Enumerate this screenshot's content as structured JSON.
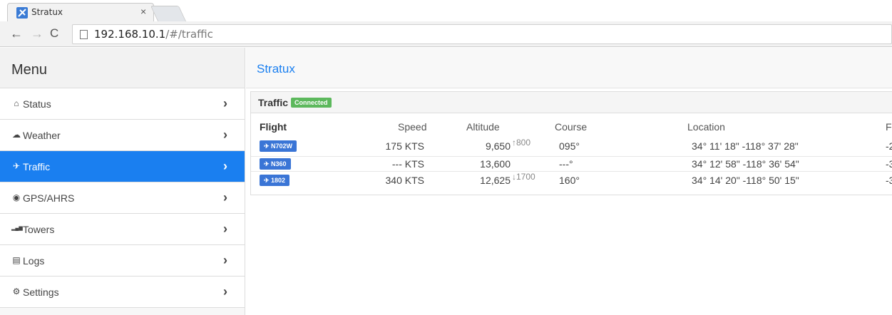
{
  "browser": {
    "tab_title": "Stratux",
    "tab_close": "×",
    "url_host": "192.168.10.1",
    "url_path": "/#/traffic",
    "back_glyph": "←",
    "forward_glyph": "→",
    "reload_glyph": "C"
  },
  "sidebar": {
    "title": "Menu",
    "items": [
      {
        "label": "Status",
        "icon": "home-icon",
        "glyph": "⌂",
        "active": false
      },
      {
        "label": "Weather",
        "icon": "cloud-icon",
        "glyph": "☁",
        "active": false
      },
      {
        "label": "Traffic",
        "icon": "plane-icon",
        "glyph": "✈",
        "active": true
      },
      {
        "label": "GPS/AHRS",
        "icon": "globe-icon",
        "glyph": "◉",
        "active": false
      },
      {
        "label": "Towers",
        "icon": "signal-icon",
        "glyph": "▂▄▆",
        "active": false
      },
      {
        "label": "Logs",
        "icon": "file-icon",
        "glyph": "▤",
        "active": false
      },
      {
        "label": "Settings",
        "icon": "gear-icon",
        "glyph": "⚙",
        "active": false
      }
    ],
    "chevron": "›"
  },
  "header": {
    "title": "Stratux"
  },
  "traffic": {
    "panel_title": "Traffic",
    "status_badge": "Connected",
    "columns": {
      "flight": "Flight",
      "speed": "Speed",
      "altitude": "Altitude",
      "course": "Course",
      "location": "Location",
      "p": "F"
    },
    "rows": [
      {
        "flight": "✈ N702W",
        "speed": "175 KTS",
        "altitude": "9,650",
        "vs": "↑800",
        "course": "095°",
        "location": "34° 11' 18\" -118° 37' 28\"",
        "p": "-2"
      },
      {
        "flight": "✈ N360",
        "speed": "--- KTS",
        "altitude": "13,600",
        "vs": "",
        "course": "---°",
        "location": "34° 12' 58\" -118° 36' 54\"",
        "p": "-3"
      },
      {
        "flight": "✈ 1802",
        "speed": "340 KTS",
        "altitude": "12,625",
        "vs": "↓1700",
        "course": "160°",
        "location": "34° 14' 20\" -118° 50' 15\"",
        "p": "-3"
      }
    ]
  },
  "colors": {
    "accent": "#1a7ff0",
    "badge": "#5cb85c",
    "flight_button": "#3a75d6"
  }
}
